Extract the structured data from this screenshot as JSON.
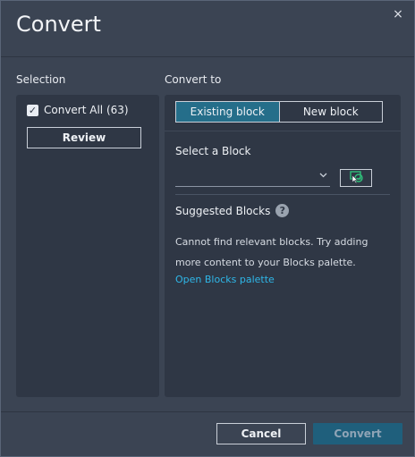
{
  "dialog": {
    "title": "Convert",
    "close_glyph": "×"
  },
  "selection": {
    "section_label": "Selection",
    "convert_all_label": "Convert All (63)",
    "convert_all_checked": true,
    "review_label": "Review"
  },
  "convert_to": {
    "section_label": "Convert to",
    "tabs": [
      {
        "label": "Existing block",
        "active": true
      },
      {
        "label": "New block",
        "active": false
      }
    ],
    "select_label": "Select a Block",
    "dropdown_value": "",
    "pick_icon": "select-block-from-drawing-icon",
    "suggested_label": "Suggested Blocks",
    "help_glyph": "?",
    "message": "Cannot find relevant blocks. Try adding more content to your Blocks palette.",
    "link_label": "Open Blocks palette"
  },
  "footer": {
    "cancel_label": "Cancel",
    "convert_label": "Convert"
  },
  "colors": {
    "accent": "#256e8a",
    "link": "#2fb7e8",
    "background": "#3b4453",
    "panel": "#2f3745"
  }
}
